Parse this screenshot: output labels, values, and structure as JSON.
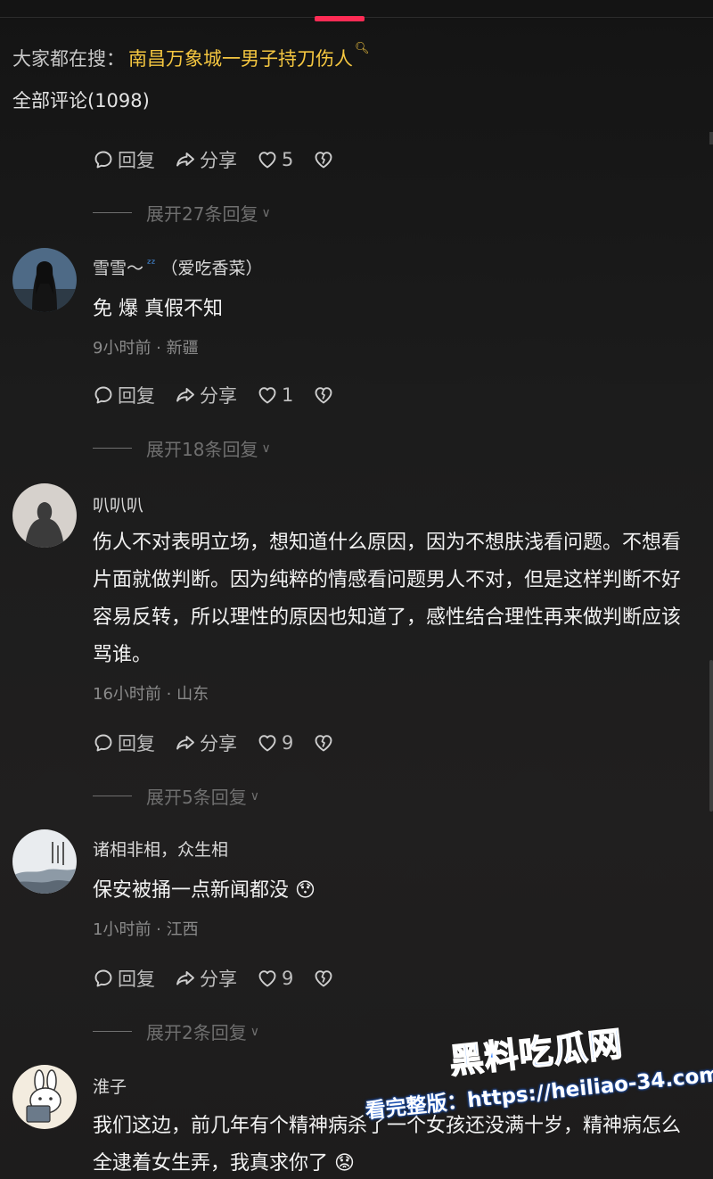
{
  "search_hint": {
    "prefix": "大家都在搜：",
    "term": "南昌万象城一男子持刀伤人"
  },
  "comment_count": "全部评论(1098)",
  "labels": {
    "reply": "回复",
    "share": "分享"
  },
  "first_block": {
    "likes": "5",
    "expand": "展开27条回复"
  },
  "comments": [
    {
      "username": "雪雪～",
      "username_suffix": "（爱吃香菜）",
      "zz": "ᶻᶻ",
      "text": "免 爆 真假不知",
      "time": "9小时前",
      "location": "新疆",
      "likes": "1",
      "expand": "展开18条回复"
    },
    {
      "username": "叭叭叭",
      "text": "伤人不对表明立场，想知道什么原因，因为不想肤浅看问题。不想看片面就做判断。因为纯粹的情感看问题男人不对，但是这样判断不好容易反转，所以理性的原因也知道了，感性结合理性再来做判断应该骂谁。",
      "time": "16小时前",
      "location": "山东",
      "likes": "9",
      "expand": "展开5条回复"
    },
    {
      "username": "诸相非相，众生相",
      "text": "保安被捅一点新闻都没 😯",
      "time": "1小时前",
      "location": "江西",
      "likes": "9",
      "expand": "展开2条回复"
    },
    {
      "username": "淮子",
      "text": "我们这边，前几年有个精神病杀了一个女孩还没满十岁，精神病怎么全逮着女生弄，我真求你了 😟"
    }
  ],
  "watermark": {
    "brand": "黑料吃瓜网",
    "line": "看完整版：https://heiliao-34.com"
  },
  "colors": {
    "accent": "#fe2c55",
    "search_term": "#f4c640",
    "background": "#1c1b1b"
  }
}
